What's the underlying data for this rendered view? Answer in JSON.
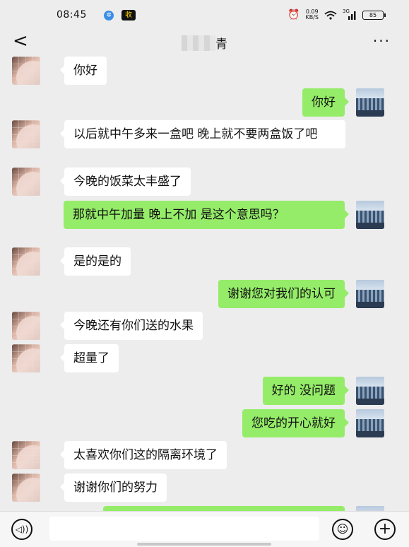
{
  "status_bar": {
    "time": "08:45",
    "app_badge_1": "✲",
    "app_badge_2": "收",
    "net_speed_value": "0.09",
    "net_speed_unit": "KB/S",
    "signal_label": "3G",
    "battery": "85"
  },
  "header": {
    "back_label": "<",
    "title": "青",
    "more_label": "···"
  },
  "messages": [
    {
      "side": "left",
      "text": "你好"
    },
    {
      "side": "right",
      "text": "你好"
    },
    {
      "side": "left",
      "text": "以后就中午多来一盒吧 晚上就不要两盒饭了吧"
    },
    {
      "side": "left",
      "text": "今晚的饭菜太丰盛了"
    },
    {
      "side": "right",
      "text": "那就中午加量 晚上不加 是这个意思吗？"
    },
    {
      "side": "left",
      "text": "是的是的"
    },
    {
      "side": "right",
      "text": "谢谢您对我们的认可"
    },
    {
      "side": "left",
      "text": "今晚还有你们送的水果"
    },
    {
      "side": "left",
      "text": "超量了"
    },
    {
      "side": "right",
      "text": "好的 没问题"
    },
    {
      "side": "right",
      "text": "您吃的开心就好"
    },
    {
      "side": "left",
      "text": "太喜欢你们这的隔离环境了"
    },
    {
      "side": "left",
      "text": "谢谢你们的努力"
    },
    {
      "side": "right",
      "text": ""
    }
  ],
  "input_bar": {
    "voice_icon": "voice-icon",
    "emoji_icon": "emoji-icon",
    "plus_icon": "plus-icon",
    "input_value": ""
  },
  "colors": {
    "background": "#ededed",
    "bubble_self": "#95ec69",
    "bubble_other": "#ffffff"
  }
}
